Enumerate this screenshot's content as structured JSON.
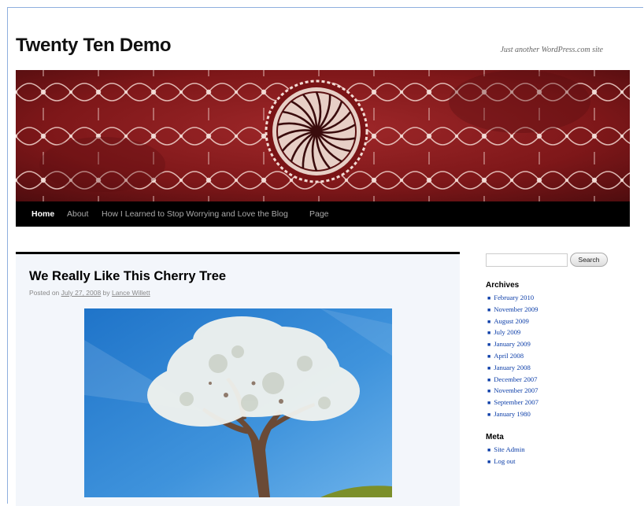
{
  "site": {
    "title": "Twenty Ten Demo",
    "tagline": "Just another WordPress.com site"
  },
  "nav": {
    "items": [
      {
        "label": "Home",
        "active": true
      },
      {
        "label": "About"
      },
      {
        "label": "How I Learned to Stop Worrying and Love the Blog"
      },
      {
        "label": "Page"
      }
    ]
  },
  "post": {
    "title": "We Really Like This Cherry Tree",
    "meta_prefix": "Posted on",
    "date": "July 27, 2008",
    "meta_by": "by",
    "author": "Lance Willett"
  },
  "sidebar": {
    "search": {
      "placeholder": "",
      "button_label": "Search"
    },
    "archives": {
      "title": "Archives",
      "items": [
        "February 2010",
        "November 2009",
        "August 2009",
        "July 2009",
        "January 2009",
        "April 2008",
        "January 2008",
        "December 2007",
        "November 2007",
        "September 2007",
        "January 1980"
      ]
    },
    "meta": {
      "title": "Meta",
      "items": [
        "Site Admin",
        "Log out"
      ]
    }
  },
  "colors": {
    "nav_background": "#000000",
    "link": "#0b3da8",
    "content_background": "#f3f6fb",
    "header_red": "#8e1c1e"
  }
}
